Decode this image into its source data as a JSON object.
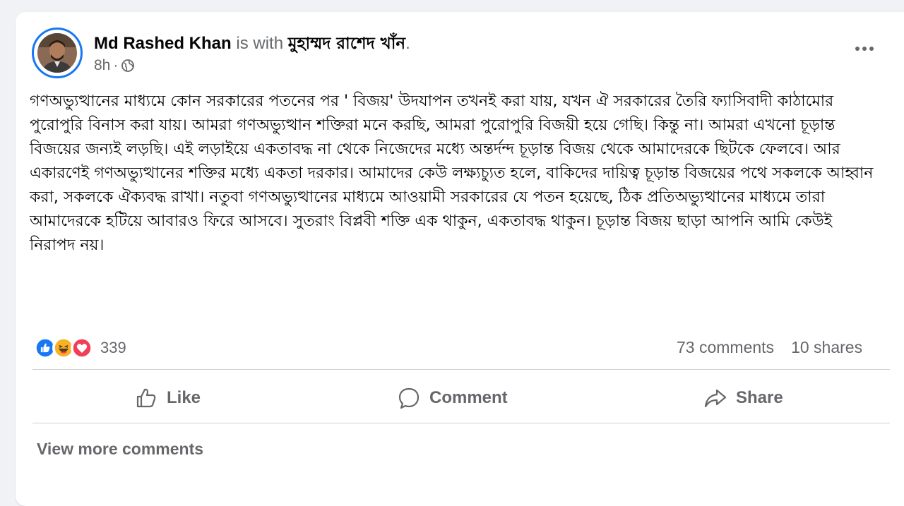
{
  "post": {
    "author_name": "Md Rashed Khan",
    "with_text": " is with ",
    "tagged_name": "মুহাম্মদ রাশেদ খাঁন",
    "tagged_suffix": ".",
    "time": "8h",
    "meta_separator": "·",
    "privacy_icon": "globe-icon",
    "more_icon": "more-options-icon",
    "text": "গণঅভ্যুত্থানের মাধ্যমে কোন সরকারের পতনের পর ' বিজয়' উদযাপন তখনই করা যায়, যখন ঐ সরকারের তৈরি ফ্যাসিবাদী কাঠামোর পুরোপুরি বিনাস করা যায়। আমরা গণঅভ্যুত্থান শক্তিরা মনে করছি, আমরা পুরোপুরি বিজয়ী হয়ে গেছি। কিন্তু না। আমরা এখনো চূড়ান্ত বিজয়ের জন্যই লড়ছি। এই লড়াইয়ে একতাবদ্ধ না থেকে নিজেদের মধ্যে অন্তর্দন্দ চূড়ান্ত বিজয় থেকে আমাদেরকে ছিটকে ফেলবে। আর একারণেই গণঅভ্যুত্থানের শক্তির মধ্যে একতা দরকার। আমাদের কেউ লক্ষ্যচ্যুত হলে, বাকিদের দায়িত্ব চূড়ান্ত বিজয়ের পথে সকলকে আহ্বান করা, সকলকে ঐক্যবদ্ধ রাখা। নতুবা গণঅভ্যুত্থানের মাধ্যমে আওয়ামী সরকারের যে পতন হয়েছে, ঠিক প্রতিঅভ্যুত্থানের মাধ্যমে তারা আমাদেরকে হটিয়ে আবারও ফিরে আসবে। সুতরাং বিপ্লবী শক্তি এক থাকুন, একতাবদ্ধ থাকুন। চূড়ান্ত বিজয় ছাড়া আপনি আমি কেউই নিরাপদ নয়।"
  },
  "reactions": {
    "icons": [
      "like-reaction-icon",
      "haha-reaction-icon",
      "love-reaction-icon"
    ],
    "count": "339"
  },
  "stats": {
    "comments": "73 comments",
    "shares": "10 shares"
  },
  "actions": {
    "like_label": "Like",
    "comment_label": "Comment",
    "share_label": "Share"
  },
  "footer": {
    "view_more_label": "View more comments"
  },
  "colors": {
    "brand_blue": "#1877f2",
    "love_red": "#f33e58",
    "haha_yellow": "#f7b125",
    "secondary_text": "#65676b",
    "primary_text": "#050505",
    "page_background": "#f0f2f5"
  }
}
